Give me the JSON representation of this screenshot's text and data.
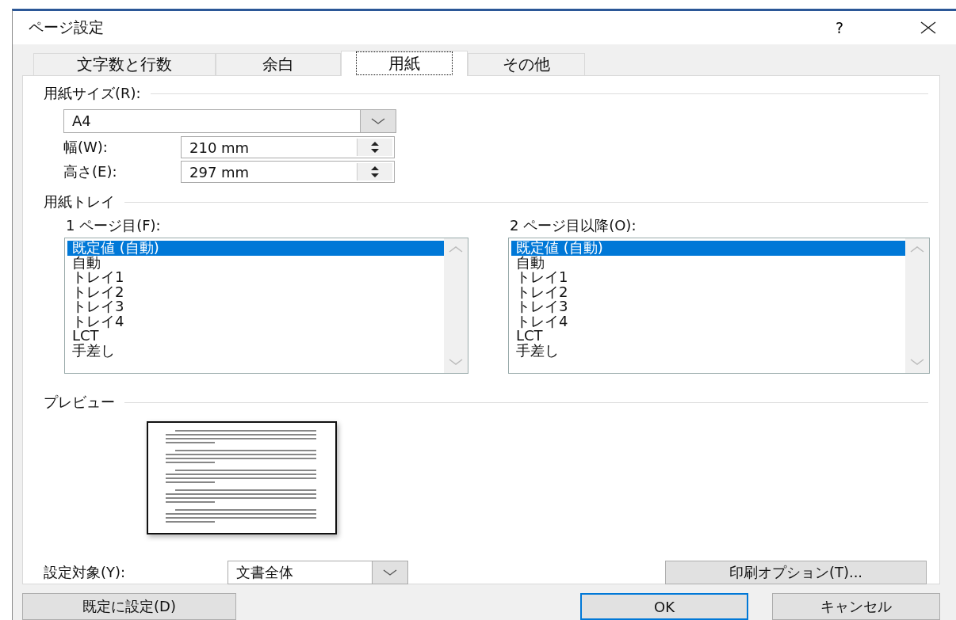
{
  "window": {
    "title": "ページ設定",
    "help": "?"
  },
  "tabs": [
    {
      "label": "文字数と行数",
      "selected": false
    },
    {
      "label": "余白",
      "selected": false
    },
    {
      "label": "用紙",
      "selected": true
    },
    {
      "label": "その他",
      "selected": false
    }
  ],
  "paper_size": {
    "heading": "用紙サイズ(R):",
    "value": "A4",
    "width": {
      "label": "幅(W):",
      "value": "210 mm"
    },
    "height": {
      "label": "高さ(E):",
      "value": "297 mm"
    }
  },
  "paper_tray": {
    "heading": "用紙トレイ",
    "lists": [
      {
        "label": "1 ページ目(F):",
        "items": [
          {
            "label": "既定値 (自動)",
            "selected": true
          },
          {
            "label": "自動",
            "selected": false
          },
          {
            "label": "トレイ1",
            "selected": false
          },
          {
            "label": "トレイ2",
            "selected": false
          },
          {
            "label": "トレイ3",
            "selected": false
          },
          {
            "label": "トレイ4",
            "selected": false
          },
          {
            "label": "LCT",
            "selected": false
          },
          {
            "label": "手差し",
            "selected": false
          }
        ]
      },
      {
        "label": "2 ページ目以降(O):",
        "items": [
          {
            "label": "既定値 (自動)",
            "selected": true
          },
          {
            "label": "自動",
            "selected": false
          },
          {
            "label": "トレイ1",
            "selected": false
          },
          {
            "label": "トレイ2",
            "selected": false
          },
          {
            "label": "トレイ3",
            "selected": false
          },
          {
            "label": "トレイ4",
            "selected": false
          },
          {
            "label": "LCT",
            "selected": false
          },
          {
            "label": "手差し",
            "selected": false
          }
        ]
      }
    ]
  },
  "preview": {
    "heading": "プレビュー"
  },
  "apply_to": {
    "label": "設定対象(Y):",
    "value": "文書全体"
  },
  "print_options_button": "印刷オプション(T)...",
  "buttons": [
    {
      "label": "既定に設定(D)",
      "default": false
    },
    {
      "label": "OK",
      "default": true
    },
    {
      "label": "キャンセル",
      "default": false
    }
  ]
}
